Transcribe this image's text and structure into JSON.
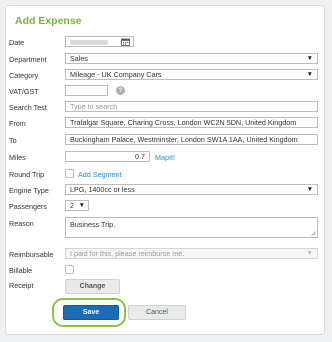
{
  "form": {
    "title": "Add Expense",
    "date": {
      "label": "Date"
    },
    "department": {
      "label": "Department",
      "value": "Sales"
    },
    "category": {
      "label": "Category",
      "value": "Mileage - UK Company Cars"
    },
    "vat": {
      "label": "VAT/GST",
      "value": "",
      "help": "?"
    },
    "search": {
      "label": "Search Test",
      "placeholder": "Type to search"
    },
    "from": {
      "label": "From",
      "value": "Trafalgar Square, Charing Cross, London WC2N 5DN, United Kingdom"
    },
    "to": {
      "label": "To",
      "value": "Buckingham Palace, Westminster, London SW1A 1AA, United Kingdom"
    },
    "miles": {
      "label": "Miles",
      "value": "0.7",
      "link": "MapIt!"
    },
    "round_trip": {
      "label": "Round Trip",
      "link": "Add Segment"
    },
    "engine_type": {
      "label": "Engine Type",
      "value": "LPG, 1400cc or less"
    },
    "passengers": {
      "label": "Passengers",
      "value": "2"
    },
    "reason": {
      "label": "Reason",
      "value": "Business Trip."
    },
    "reimbursable": {
      "label": "Reimbursable",
      "value": "I paid for this, please reimburse me."
    },
    "billable": {
      "label": "Billable"
    },
    "receipt": {
      "label": "Receipt",
      "button": "Change"
    },
    "save_label": "Save",
    "cancel_label": "Cancel"
  },
  "colors": {
    "accent_green": "#7cb342",
    "primary_blue": "#1a6db3",
    "link_blue": "#2b8fd0"
  },
  "icons": {
    "date": "calendar-icon",
    "select": "chevron-down-icon",
    "help": "help-icon"
  }
}
